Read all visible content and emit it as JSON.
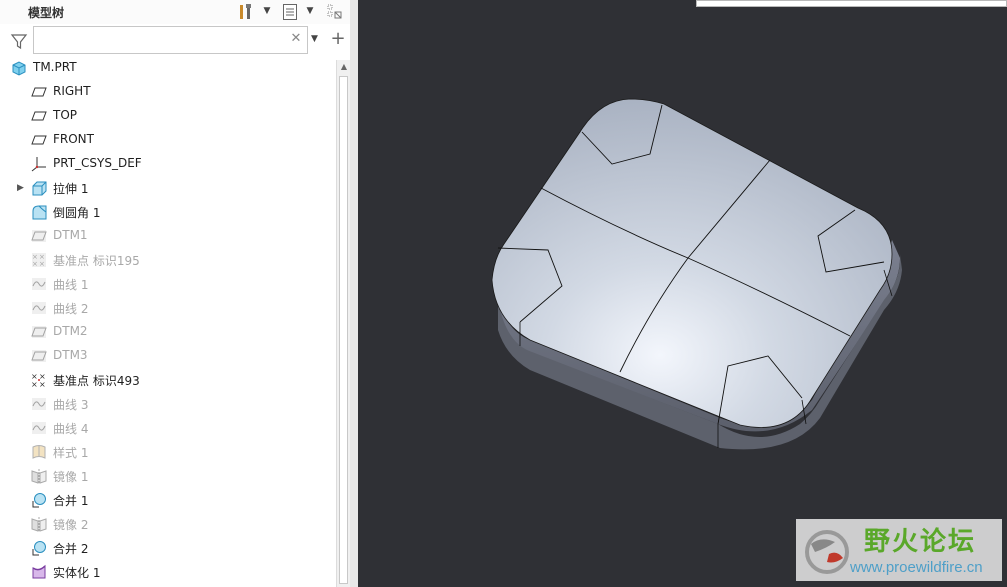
{
  "panel": {
    "title": "模型树",
    "filter_placeholder": ""
  },
  "tree": {
    "items": [
      {
        "label": "TM.PRT",
        "icon": "part-icon",
        "dim": false
      },
      {
        "label": "RIGHT",
        "icon": "datum-plane-icon",
        "dim": false
      },
      {
        "label": "TOP",
        "icon": "datum-plane-icon",
        "dim": false
      },
      {
        "label": "FRONT",
        "icon": "datum-plane-icon",
        "dim": false
      },
      {
        "label": "PRT_CSYS_DEF",
        "icon": "coordinate-system-icon",
        "dim": false
      },
      {
        "label": "拉伸 1",
        "icon": "extrude-icon",
        "dim": false
      },
      {
        "label": "倒圆角 1",
        "icon": "round-icon",
        "dim": false
      },
      {
        "label": "DTM1",
        "icon": "datum-plane-icon",
        "dim": true
      },
      {
        "label": "基准点 标识195",
        "icon": "datum-point-icon",
        "dim": true
      },
      {
        "label": "曲线 1",
        "icon": "curve-icon",
        "dim": true
      },
      {
        "label": "曲线 2",
        "icon": "curve-icon",
        "dim": true
      },
      {
        "label": "DTM2",
        "icon": "datum-plane-icon",
        "dim": true
      },
      {
        "label": "DTM3",
        "icon": "datum-plane-icon",
        "dim": true
      },
      {
        "label": "基准点 标识493",
        "icon": "datum-point-icon",
        "dim": false
      },
      {
        "label": "曲线 3",
        "icon": "curve-icon",
        "dim": true
      },
      {
        "label": "曲线 4",
        "icon": "curve-icon",
        "dim": true
      },
      {
        "label": "样式 1",
        "icon": "style-icon",
        "dim": true
      },
      {
        "label": "镜像 1",
        "icon": "mirror-icon",
        "dim": true
      },
      {
        "label": "合并 1",
        "icon": "merge-icon",
        "dim": false
      },
      {
        "label": "镜像 2",
        "icon": "mirror-icon",
        "dim": true
      },
      {
        "label": "合并 2",
        "icon": "merge-icon",
        "dim": false
      },
      {
        "label": "实体化 1",
        "icon": "solidify-icon",
        "dim": false
      }
    ]
  },
  "watermark": {
    "title": "野火论坛",
    "url": "www.proewildfire.cn"
  },
  "colors": {
    "viewport_bg": "#2f3035",
    "watermark_green": "#5aa82a",
    "watermark_blue": "#4e9fc8"
  }
}
